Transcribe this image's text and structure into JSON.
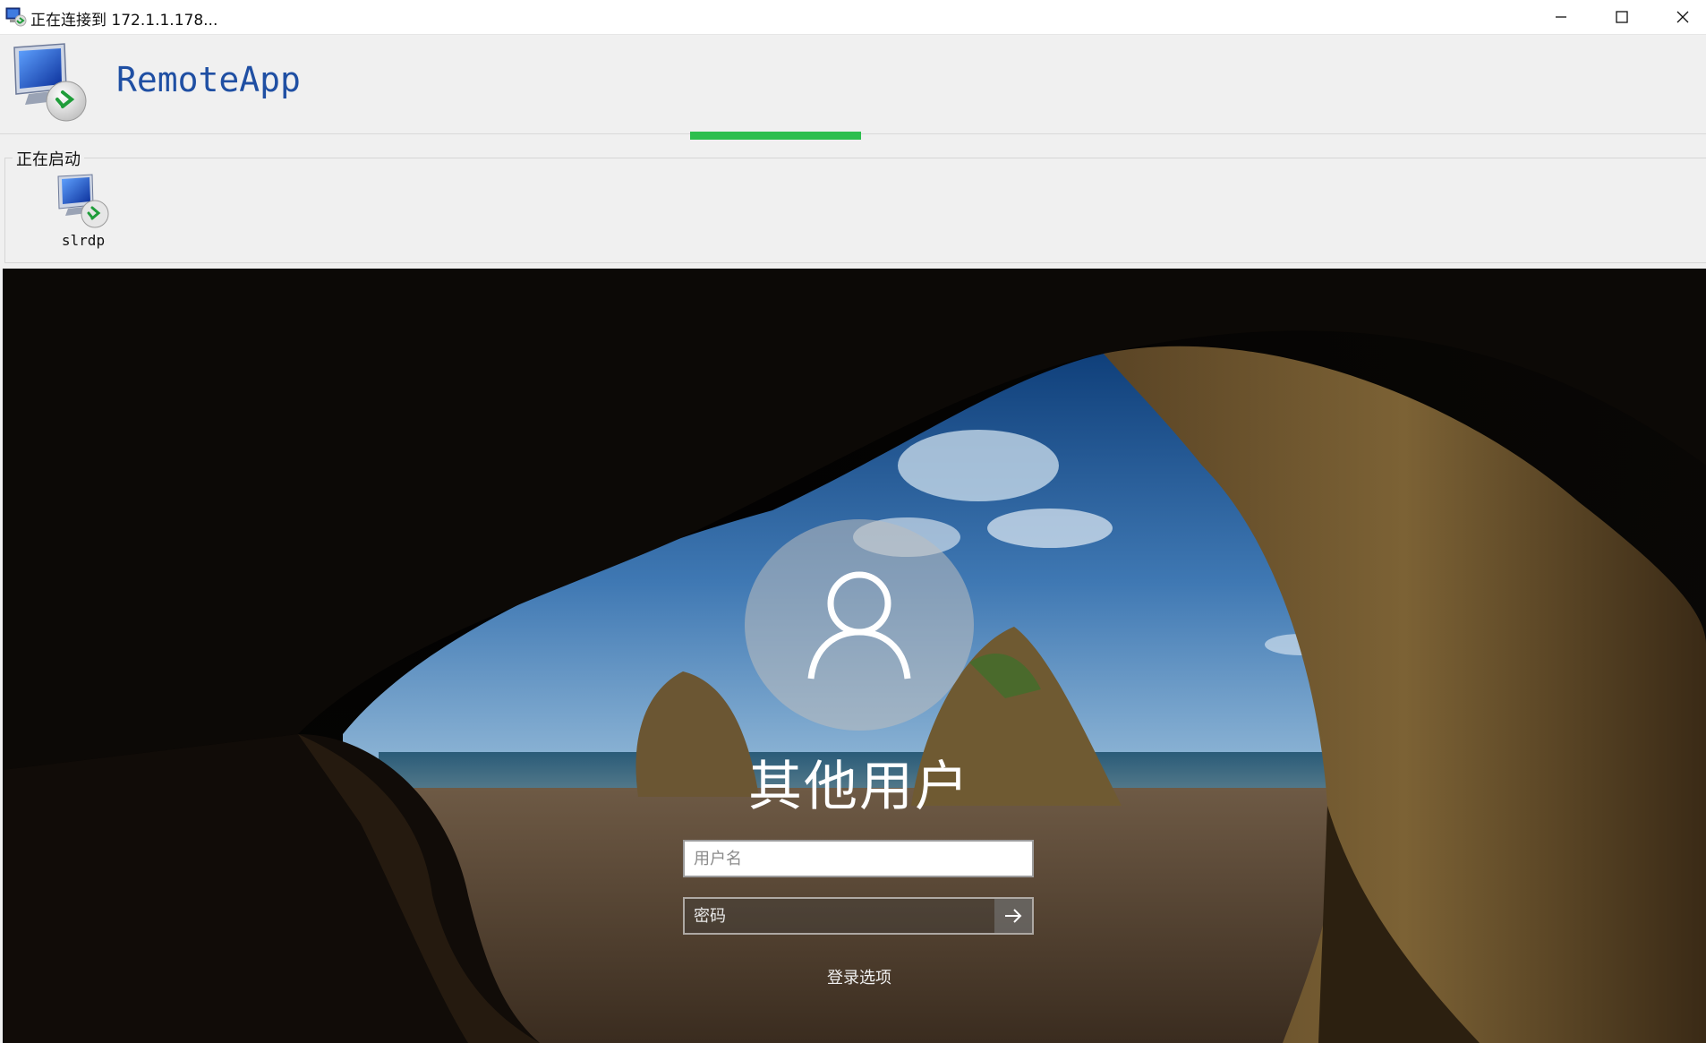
{
  "window": {
    "title": "正在连接到 172.1.1.178...",
    "icon": "remote-desktop-icon"
  },
  "window_controls": {
    "minimize_icon": "minimize-icon",
    "maximize_icon": "maximize-icon",
    "close_icon": "close-icon"
  },
  "header": {
    "product_name": "RemoteApp",
    "icon": "remote-desktop-icon"
  },
  "progress": {
    "color": "#2dbe4e"
  },
  "startup_group": {
    "label": "正在启动",
    "items": [
      {
        "label": "slrdp",
        "icon": "remote-desktop-icon"
      }
    ]
  },
  "login": {
    "user_display_name": "其他用户",
    "avatar_icon": "user-icon",
    "username_placeholder": "用户名",
    "password_placeholder": "密码",
    "submit_icon": "arrow-right-icon",
    "sign_in_options": "登录选项"
  }
}
